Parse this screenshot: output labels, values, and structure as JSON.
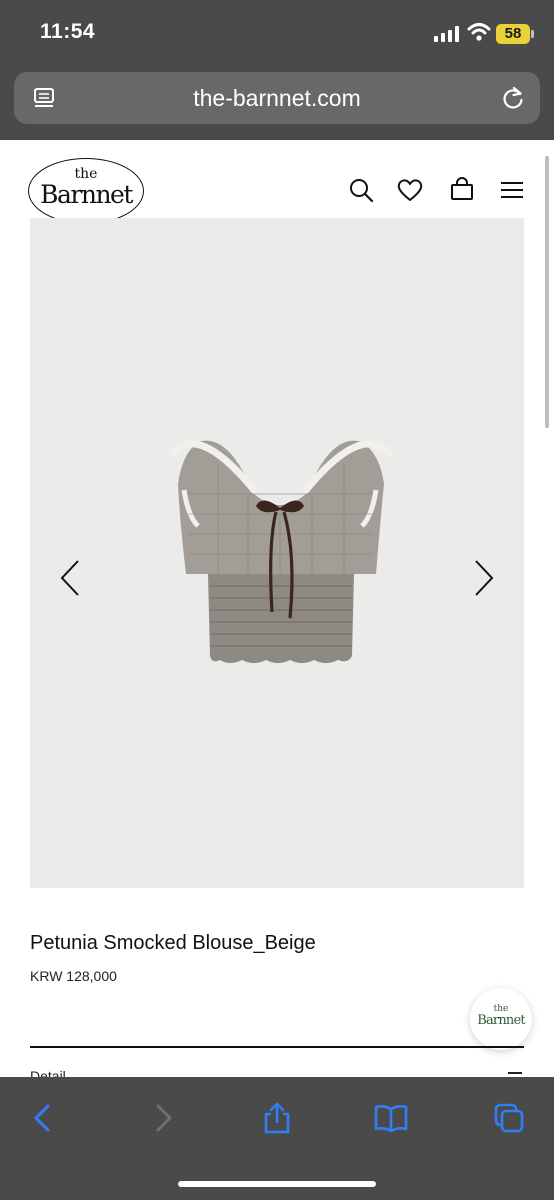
{
  "status_bar": {
    "time": "11:54",
    "battery": "58",
    "battery_color": "#e9d236"
  },
  "browser": {
    "url": "the-barnnet.com",
    "reader_icon": "reader-icon",
    "reload_icon": "reload-icon",
    "toolbar": [
      "back-icon",
      "forward-icon",
      "share-icon",
      "bookmarks-icon",
      "tabs-icon"
    ],
    "accent": "#2f7ff6"
  },
  "site": {
    "logo_the": "the",
    "logo_name": "Barnnet",
    "header_icons": [
      "search-icon",
      "heart-icon",
      "cart-icon",
      "menu-icon"
    ]
  },
  "product": {
    "title": "Petunia Smocked Blouse_Beige",
    "price": "KRW 128,000",
    "detail_label": "Detail",
    "image_background": "#ebebe9"
  },
  "chat_badge": {
    "the": "the",
    "name": "Barnnet"
  }
}
